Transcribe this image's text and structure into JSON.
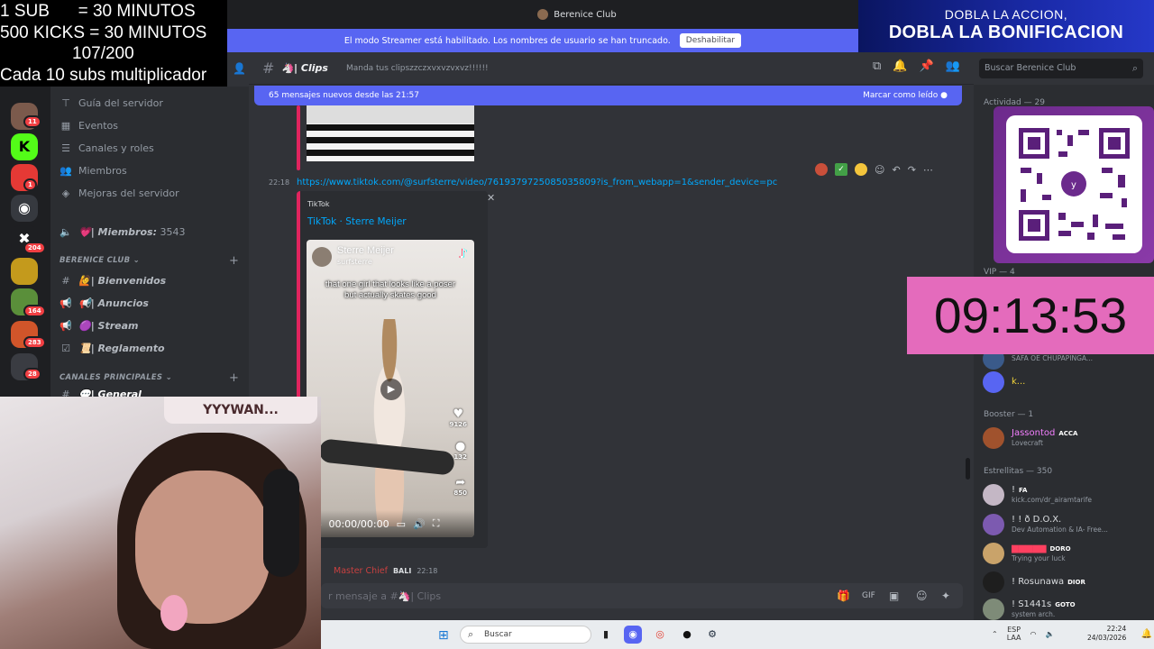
{
  "window": {
    "title": "Berenice Club"
  },
  "streamer_banner": {
    "text": "El modo Streamer está habilitado. Los nombres de usuario se han truncado.",
    "button": "Deshabilitar"
  },
  "overlay_top": {
    "lines": [
      "1 SUB      = 30 MINUTOS",
      "500 KICKS = 30 MINUTOS",
      "107/200",
      "Cada 10 subs multiplicador"
    ]
  },
  "overlay_bonus": {
    "line1": "DOBLA LA ACCION,",
    "line2": "DOBLA LA BONIFICACION"
  },
  "guilds": {
    "badges": [
      "11",
      "1",
      "204",
      "164",
      "283",
      "28"
    ]
  },
  "channels": {
    "top_items": [
      {
        "icon": "signpost-icon",
        "label": "Guía del servidor"
      },
      {
        "icon": "calendar-icon",
        "label": "Eventos"
      },
      {
        "icon": "list-icon",
        "label": "Canales y roles"
      },
      {
        "icon": "members-icon",
        "label": "Miembros"
      },
      {
        "icon": "boost-icon",
        "label": "Mejoras del servidor"
      }
    ],
    "members_count_channel": {
      "name": "💗| Miembros:",
      "count": "3543"
    },
    "category1": "BERENICE CLUB",
    "cat1_channels": [
      "🙋| Bienvenidos",
      "📢| Anuncios",
      "🟣| Stream",
      "📜| Reglamento"
    ],
    "category2": "CANALES PRINCIPALES",
    "cat2_channels": [
      "💬| General"
    ]
  },
  "header": {
    "channel": "🦄| Clips",
    "topic": "Manda tus clipszzczxvxvzvxvz!!!!!!"
  },
  "search": {
    "placeholder": "Buscar Berenice Club"
  },
  "new_messages": {
    "text": "65 mensajes nuevos desde las 21:57",
    "action": "Marcar como leído"
  },
  "message": {
    "time": "22:18",
    "link": "https://www.tiktok.com/@surfsterre/video/7619379725085035809?is_from_webapp=1&sender_device=pc",
    "embed": {
      "provider": "TikTok",
      "title": "TikTok · Sterre Meijer",
      "video_name": "Sterre Meijer",
      "video_handle": "surfsterre",
      "caption": "that one girl that looks like a poser but actually skates good",
      "likes": "9126",
      "comments": "132",
      "shares": "850",
      "time": "00:00/00:00"
    }
  },
  "next_message": {
    "author": "Master Chief",
    "tag": "BALI",
    "time": "22:18"
  },
  "composer": {
    "placeholder": "r mensaje a #🦄| Clips"
  },
  "members": {
    "group_activity": "Actividad — 29",
    "group_vip": "VIP — 4",
    "group_booster": "Booster — 1",
    "group_stars": "Estrellitas — 350",
    "vip_item1_sub": "SAFA OE CHUPAPINGA...",
    "vip_item2": "k...",
    "booster": {
      "name": "Jassontod",
      "tag": "ACCA",
      "sub": "Lovecraft"
    },
    "stars": [
      {
        "name": "!",
        "tag": "FA",
        "sub": "kick.com/dr_airamtarife",
        "color": "#dbdee1",
        "av": "#c4b7c5"
      },
      {
        "name": "! ! ð D.O.X.",
        "tag": "",
        "sub": "Dev Automation & IA- Free...",
        "color": "#dbdee1",
        "av": "#7c5ab0"
      },
      {
        "name": "",
        "tag": "DORO",
        "sub": "Trying your luck",
        "color": "#ff4060",
        "av": "#c9a36a"
      },
      {
        "name": "! Rosunawa",
        "tag": "DIOR",
        "sub": "",
        "color": "#dbdee1",
        "av": "#1e1e1e"
      },
      {
        "name": "! S1441s",
        "tag": "GOTO",
        "sub": "system arch.",
        "color": "#dbdee1",
        "av": "#7e8b78"
      }
    ]
  },
  "timer": {
    "value": "09:13:53"
  },
  "cam": {
    "tag": "YYYWAN..."
  },
  "taskbar": {
    "search": "Buscar",
    "lang": "ESP",
    "layout": "LAA",
    "time": "22:24",
    "date": "24/03/2026"
  }
}
